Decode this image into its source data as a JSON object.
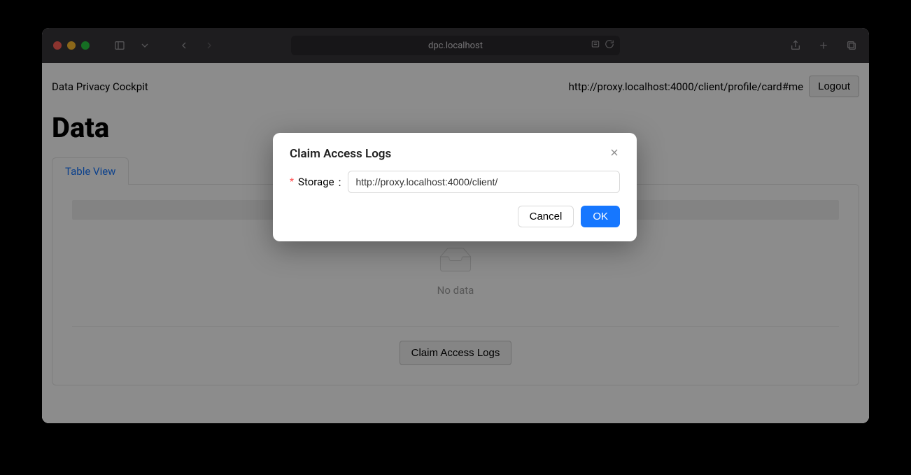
{
  "browser": {
    "url_display": "dpc.localhost"
  },
  "app": {
    "name": "Data Privacy Cockpit",
    "profile_url": "http://proxy.localhost:4000/client/profile/card#me",
    "logout_label": "Logout",
    "page_title": "Data"
  },
  "tabs": {
    "active_label": "Table View"
  },
  "empty": {
    "text": "No data"
  },
  "actions": {
    "claim_label": "Claim Access Logs"
  },
  "modal": {
    "title": "Claim Access Logs",
    "storage_label": "Storage",
    "storage_value": "http://proxy.localhost:4000/client/",
    "cancel_label": "Cancel",
    "ok_label": "OK"
  }
}
